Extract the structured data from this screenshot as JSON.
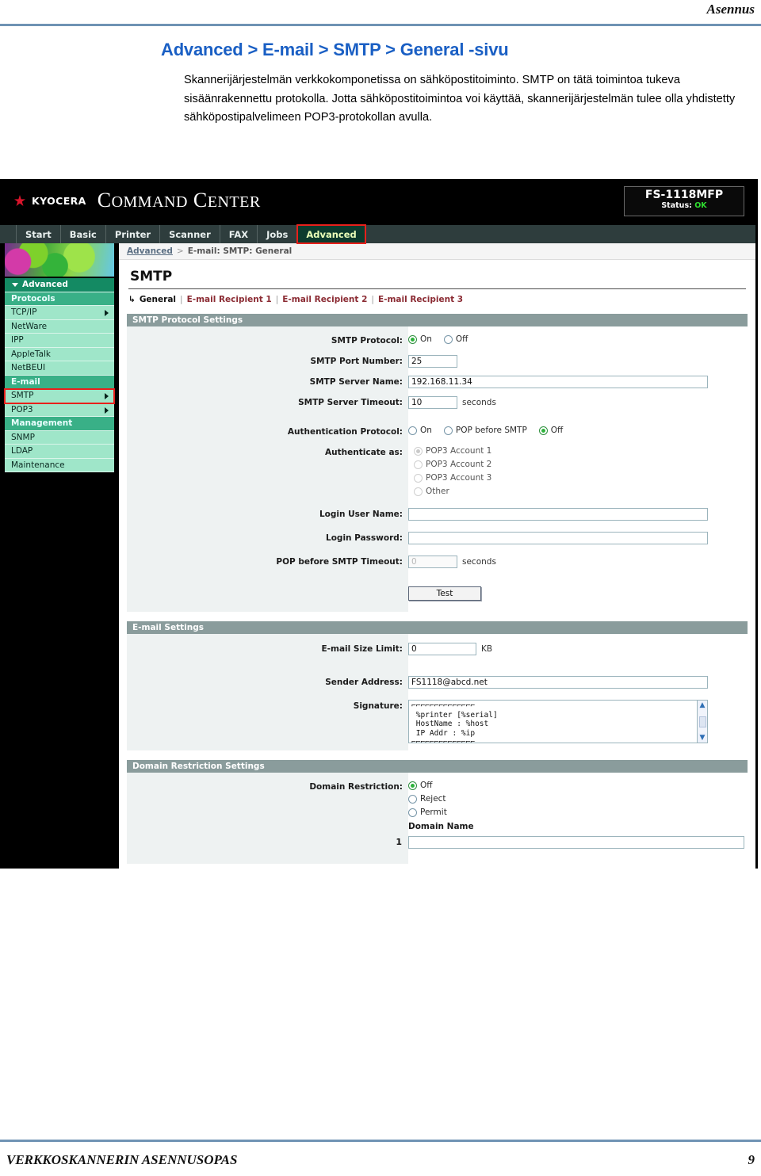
{
  "document": {
    "header_right": "Asennus",
    "footer_left": "VERKKOSKANNERIN ASENNUSOPAS",
    "footer_page": "9",
    "title": "Advanced > E-mail > SMTP > General -sivu",
    "paragraph": "Skannerijärjestelmän verkkokomponetissa on sähköpostitoiminto. SMTP on tätä toimintoa tukeva sisäänrakennettu protokolla. Jotta sähköpostitoimintoa voi käyttää, skannerijärjestelmän tulee olla yhdistetty sähköpostipalvelimeen POP3-protokollan avulla."
  },
  "app": {
    "brand_mark": "kyocera-logo-icon",
    "brand_vendor": "KYOCERA",
    "brand_product_a": "C",
    "brand_product_b": "OMMAND",
    "brand_product_c": "C",
    "brand_product_d": "ENTER",
    "device": {
      "model": "FS-1118MFP",
      "status_label": "Status:",
      "status_value": "OK"
    },
    "tabs": [
      {
        "label": "Start",
        "active": false
      },
      {
        "label": "Basic",
        "active": false
      },
      {
        "label": "Printer",
        "active": false
      },
      {
        "label": "Scanner",
        "active": false
      },
      {
        "label": "FAX",
        "active": false
      },
      {
        "label": "Jobs",
        "active": false
      },
      {
        "label": "Advanced",
        "active": true
      }
    ],
    "breadcrumb": {
      "root": "Advanced",
      "separator": ">",
      "current": "E-mail: SMTP: General"
    },
    "sidebar": {
      "title": "Advanced",
      "items": [
        {
          "label": "Protocols",
          "type": "head"
        },
        {
          "label": "TCP/IP",
          "type": "item",
          "arrow": true
        },
        {
          "label": "NetWare",
          "type": "item",
          "arrow": false
        },
        {
          "label": "IPP",
          "type": "item",
          "arrow": false
        },
        {
          "label": "AppleTalk",
          "type": "item",
          "arrow": false
        },
        {
          "label": "NetBEUI",
          "type": "item",
          "arrow": false
        },
        {
          "label": "E-mail",
          "type": "head"
        },
        {
          "label": "SMTP",
          "type": "item",
          "arrow": true,
          "marked": true
        },
        {
          "label": "POP3",
          "type": "item",
          "arrow": true
        },
        {
          "label": "Management",
          "type": "head"
        },
        {
          "label": "SNMP",
          "type": "item",
          "arrow": false
        },
        {
          "label": "LDAP",
          "type": "item",
          "arrow": false
        },
        {
          "label": "Maintenance",
          "type": "item",
          "arrow": false
        }
      ]
    },
    "page": {
      "heading": "SMTP",
      "subtabs": {
        "hook": "↳",
        "current": "General",
        "sep": "|",
        "links": [
          "E-mail Recipient 1",
          "E-mail Recipient 2",
          "E-mail Recipient 3"
        ]
      }
    },
    "sections": {
      "protocol": {
        "heading": "SMTP Protocol Settings",
        "smtp_protocol_label": "SMTP Protocol:",
        "smtp_protocol_on": "On",
        "smtp_protocol_off": "Off",
        "smtp_protocol_value": "On",
        "port_label": "SMTP Port Number:",
        "port_value": "25",
        "server_label": "SMTP Server Name:",
        "server_value": "192.168.11.34",
        "timeout_label": "SMTP Server Timeout:",
        "timeout_value": "10",
        "timeout_units": "seconds",
        "auth_label": "Authentication Protocol:",
        "auth_on": "On",
        "auth_pop": "POP before SMTP",
        "auth_off": "Off",
        "auth_value": "Off",
        "authas_label": "Authenticate as:",
        "authas_options": [
          "POP3 Account 1",
          "POP3 Account 2",
          "POP3 Account 3",
          "Other"
        ],
        "authas_value": "POP3 Account 1",
        "login_user_label": "Login User Name:",
        "login_user_value": "",
        "login_pass_label": "Login Password:",
        "login_pass_value": "",
        "pop_timeout_label": "POP before SMTP Timeout:",
        "pop_timeout_value": "0",
        "pop_timeout_units": "seconds",
        "test_button": "Test"
      },
      "email": {
        "heading": "E-mail Settings",
        "size_label": "E-mail Size Limit:",
        "size_value": "0",
        "size_units": "KB",
        "sender_label": "Sender Address:",
        "sender_value": "FS1118@abcd.net",
        "signature_label": "Signature:",
        "signature_value": "⌐⌐⌐⌐⌐⌐⌐⌐⌐⌐⌐⌐⌐⌐\n %printer [%serial]\n HostName : %host\n IP Addr : %ip\n⌐⌐⌐⌐⌐⌐⌐⌐⌐⌐⌐⌐⌐⌐",
        "scroll_up": "▲",
        "scroll_down": "▼"
      },
      "domain": {
        "heading": "Domain Restriction Settings",
        "restriction_label": "Domain Restriction:",
        "options": [
          "Off",
          "Reject",
          "Permit"
        ],
        "value": "Off",
        "domain_name_label": "Domain Name",
        "row_index": "1",
        "domain_value": ""
      }
    }
  }
}
